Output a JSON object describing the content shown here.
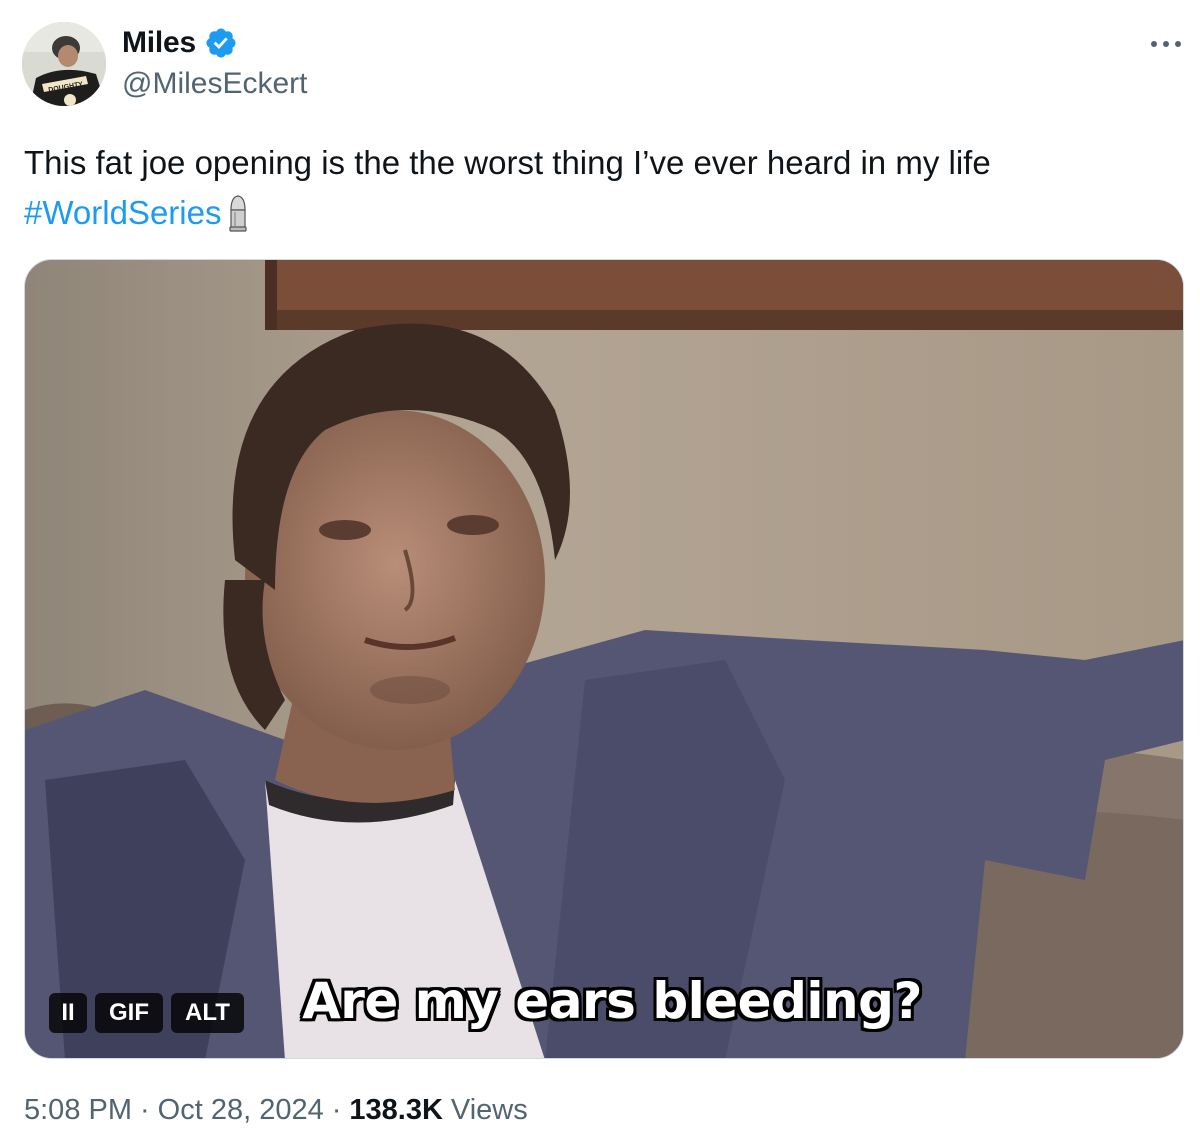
{
  "author": {
    "display_name": "Miles",
    "handle": "@MilesEckert",
    "verified": true,
    "avatar_jersey_text": "DOUGHTY"
  },
  "tweet": {
    "text": "This fat joe opening is the the worst thing I’ve ever heard in my life",
    "hashtag": "#WorldSeries",
    "emoji": "bullet-emoji"
  },
  "media": {
    "type": "GIF",
    "caption": "Are my ears bleeding?",
    "controls": {
      "pause_label": "II",
      "gif_label": "GIF",
      "alt_label": "ALT"
    }
  },
  "footer": {
    "time": "5:08 PM",
    "separator": "·",
    "date": "Oct 28, 2024",
    "views_count": "138.3K",
    "views_label": "Views"
  },
  "icons": {
    "verified": "verified-badge-icon",
    "more": "more-options-icon"
  },
  "colors": {
    "link": "#1d9bf0",
    "secondary_text": "#536471",
    "verified": "#1d9bf0"
  }
}
